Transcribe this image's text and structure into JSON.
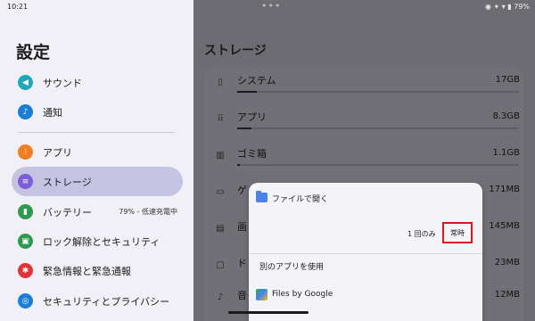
{
  "status": {
    "time": "10:21",
    "right": "◉ ✦ ▾ ▮ 79%"
  },
  "settings": {
    "title": "設定",
    "items": [
      {
        "label": "サウンド",
        "sub": "",
        "icon": "speaker-icon",
        "color": "#20a8b8"
      },
      {
        "label": "通知",
        "sub": "",
        "icon": "bell-icon",
        "color": "#1a7fd4"
      },
      {
        "label": "アプリ",
        "sub": "",
        "icon": "apps-grid-icon",
        "color": "#f07f23"
      },
      {
        "label": "ストレージ",
        "sub": "",
        "icon": "storage-icon",
        "color": "#7b5fd8"
      },
      {
        "label": "バッテリー",
        "sub": "79% - 低速充電中",
        "icon": "battery-icon",
        "color": "#2e9a4e"
      },
      {
        "label": "ロック解除とセキュリティ",
        "sub": "",
        "icon": "lock-icon",
        "color": "#2e9a4e"
      },
      {
        "label": "緊急情報と緊急通報",
        "sub": "",
        "icon": "asterisk-icon",
        "color": "#e0343a"
      },
      {
        "label": "セキュリティとプライバシー",
        "sub": "",
        "icon": "privacy-icon",
        "color": "#1a7fd4"
      }
    ]
  },
  "storage": {
    "title": "ストレージ",
    "rows": [
      {
        "label": "システム",
        "value": "17GB",
        "icon": "phone-icon",
        "fraction": 0.07
      },
      {
        "label": "アプリ",
        "value": "8.3GB",
        "icon": "grid-icon",
        "fraction": 0.05
      },
      {
        "label": "ゴミ箱",
        "value": "1.1GB",
        "icon": "trash-icon",
        "fraction": 0.01
      },
      {
        "label": "ゲ",
        "value": "171MB",
        "icon": "gamepad-icon",
        "fraction": 0
      },
      {
        "label": "画",
        "value": "145MB",
        "icon": "image-icon",
        "fraction": 0
      },
      {
        "label": "ド",
        "value": "23MB",
        "icon": "folder-icon",
        "fraction": 0
      },
      {
        "label": "音",
        "value": "12MB",
        "icon": "music-icon",
        "fraction": 0
      }
    ]
  },
  "dialog": {
    "title": "ファイルで開く",
    "once_label": "1 回のみ",
    "always_label": "常時",
    "section": "別のアプリを使用",
    "app_name": "Files by Google"
  }
}
